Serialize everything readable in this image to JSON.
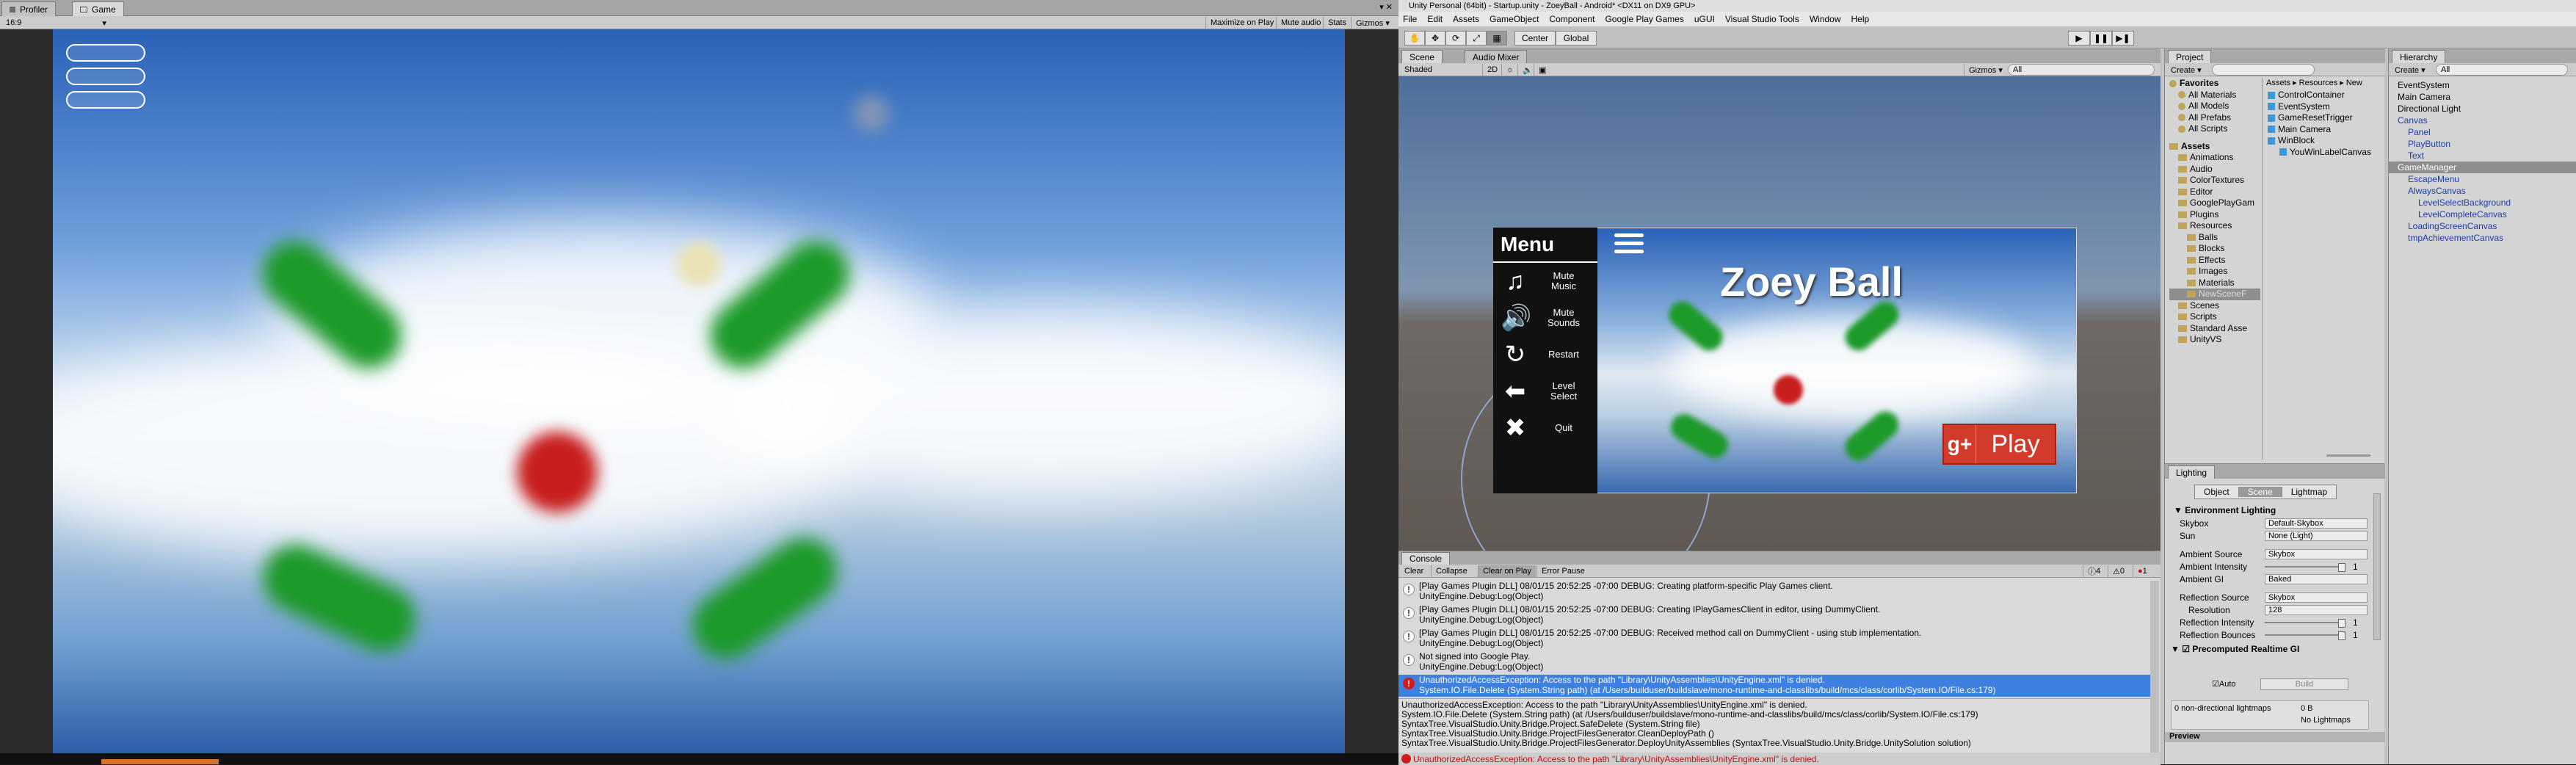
{
  "game_window": {
    "tabs": [
      {
        "label": "Profiler"
      },
      {
        "label": "Game"
      }
    ],
    "aspect": "16:9",
    "toolbar_buttons": [
      "Maximize on Play",
      "Mute audio",
      "Stats",
      "Gizmos ▾"
    ]
  },
  "editor": {
    "title": "Unity Personal (64bit) - Startup.unity - ZoeyBall - Android* <DX11 on DX9 GPU>",
    "menu": [
      "File",
      "Edit",
      "Assets",
      "GameObject",
      "Component",
      "Google Play Games",
      "uGUI",
      "Visual Studio Tools",
      "Window",
      "Help"
    ],
    "pivot_label": "Center",
    "space_label": "Global",
    "scene_tabs": [
      {
        "label": "Scene"
      },
      {
        "label": "Audio Mixer"
      }
    ],
    "scene_bar": {
      "shading": "Shaded",
      "mode": "2D",
      "gizmos": "Gizmos ▾",
      "search": "All"
    }
  },
  "scene_preview": {
    "title": "Zoey Ball",
    "play_label": "Play",
    "gplus": "g+",
    "menu_title": "Menu",
    "menu_items": [
      {
        "label": "Mute Music"
      },
      {
        "label": "Mute Sounds"
      },
      {
        "label": "Restart"
      },
      {
        "label": "Level Select"
      },
      {
        "label": "Quit"
      }
    ]
  },
  "console": {
    "tab": "Console",
    "buttons": [
      "Clear",
      "Collapse",
      "Clear on Play",
      "Error Pause"
    ],
    "counts": {
      "info": "4",
      "warn": "0",
      "error": "1"
    },
    "logs": [
      {
        "line1": "[Play Games Plugin DLL] 08/01/15 20:52:25 -07:00 DEBUG: Creating platform-specific Play Games client.",
        "line2": "UnityEngine.Debug:Log(Object)"
      },
      {
        "line1": "[Play Games Plugin DLL] 08/01/15 20:52:25 -07:00 DEBUG: Creating IPlayGamesClient in editor, using DummyClient.",
        "line2": "UnityEngine.Debug:Log(Object)"
      },
      {
        "line1": "[Play Games Plugin DLL] 08/01/15 20:52:25 -07:00 DEBUG: Received method call on DummyClient - using stub implementation.",
        "line2": "UnityEngine.Debug:Log(Object)"
      },
      {
        "line1": "Not signed into Google Play.",
        "line2": "UnityEngine.Debug:Log(Object)"
      }
    ],
    "error": {
      "line1": "UnauthorizedAccessException: Access to the path \"Library\\UnityAssemblies\\UnityEngine.xml\" is denied.",
      "line2": "System.IO.File.Delete (System.String path) (at /Users/builduser/buildslave/mono-runtime-and-classlibs/build/mcs/class/corlib/System.IO/File.cs:179)"
    },
    "detail": [
      "UnauthorizedAccessException: Access to the path \"Library\\UnityAssemblies\\UnityEngine.xml\" is denied.",
      "System.IO.File.Delete (System.String path) (at /Users/builduser/buildslave/mono-runtime-and-classlibs/build/mcs/class/corlib/System.IO/File.cs:179)",
      "SyntaxTree.VisualStudio.Unity.Bridge.Project.SafeDelete (System.String file)",
      "SyntaxTree.VisualStudio.Unity.Bridge.ProjectFilesGenerator.CleanDeployPath ()",
      "SyntaxTree.VisualStudio.Unity.Bridge.ProjectFilesGenerator.DeployUnityAssemblies (SyntaxTree.VisualStudio.Unity.Bridge.UnitySolution solution)"
    ],
    "status": "UnauthorizedAccessException: Access to the path \"Library\\UnityAssemblies\\UnityEngine.xml\" is denied."
  },
  "project": {
    "tab": "Project",
    "create": "Create ▾",
    "favorites": [
      "Favorites",
      "All Materials",
      "All Models",
      "All Prefabs",
      "All Scripts"
    ],
    "assets_tree": [
      "Assets",
      "Animations",
      "Audio",
      "ColorTextures",
      "Editor",
      "GooglePlayGam",
      "Plugins",
      "Resources",
      "Balls",
      "Blocks",
      "Effects",
      "Images",
      "Materials",
      "NewSceneF",
      "Scenes",
      "Scripts",
      "Standard Asse",
      "UnityVS"
    ],
    "breadcrumb": "Assets ▸ Resources ▸ New",
    "files": [
      "ControlContainer",
      "EventSystem",
      "GameResetTrigger",
      "Main Camera",
      "WinBlock",
      "YouWinLabelCanvas"
    ]
  },
  "lighting": {
    "tab": "Lighting",
    "tabs": [
      "Object",
      "Scene",
      "Lightmap"
    ],
    "section": "Environment Lighting",
    "rows": [
      {
        "label": "Skybox",
        "value": "Default-Skybox"
      },
      {
        "label": "Sun",
        "value": "None (Light)"
      },
      {
        "label": "Ambient Source",
        "value": "Skybox"
      },
      {
        "label": "Ambient Intensity",
        "value": "1"
      },
      {
        "label": "Ambient GI",
        "value": "Baked"
      },
      {
        "label": "Reflection Source",
        "value": "Skybox"
      },
      {
        "label": "Resolution",
        "value": "128"
      },
      {
        "label": "Reflection Intensity",
        "value": "1"
      },
      {
        "label": "Reflection Bounces",
        "value": "1"
      }
    ],
    "precomputed": "Precomputed Realtime GI",
    "auto": "Auto",
    "build": "Build",
    "lightmaps": "0 non-directional lightmaps",
    "lightmap_size": "0 B",
    "no_lightmaps": "No Lightmaps",
    "preview": "Preview"
  },
  "hierarchy": {
    "tab": "Hierarchy",
    "create": "Create ▾",
    "search": "All",
    "items": [
      {
        "label": "EventSystem",
        "indent": 0,
        "color": "#000000"
      },
      {
        "label": "Main Camera",
        "indent": 0,
        "color": "#000000"
      },
      {
        "label": "Directional Light",
        "indent": 0,
        "color": "#000000"
      },
      {
        "label": "Canvas",
        "indent": 0,
        "color": "#1a3fa8"
      },
      {
        "label": "Panel",
        "indent": 1,
        "color": "#1a3fa8"
      },
      {
        "label": "PlayButton",
        "indent": 1,
        "color": "#1a3fa8"
      },
      {
        "label": "Text",
        "indent": 1,
        "color": "#1a3fa8"
      },
      {
        "label": "GameManager",
        "indent": 0,
        "color": "#ffffff"
      },
      {
        "label": "EscapeMenu",
        "indent": 1,
        "color": "#1a3fa8"
      },
      {
        "label": "AlwaysCanvas",
        "indent": 1,
        "color": "#1a3fa8"
      },
      {
        "label": "LevelSelectBackground",
        "indent": 2,
        "color": "#1a3fa8"
      },
      {
        "label": "LevelCompleteCanvas",
        "indent": 2,
        "color": "#1a3fa8"
      },
      {
        "label": "LoadingScreenCanvas",
        "indent": 1,
        "color": "#1a3fa8"
      },
      {
        "label": "tmpAchievementCanvas",
        "indent": 1,
        "color": "#1a3fa8"
      }
    ]
  }
}
